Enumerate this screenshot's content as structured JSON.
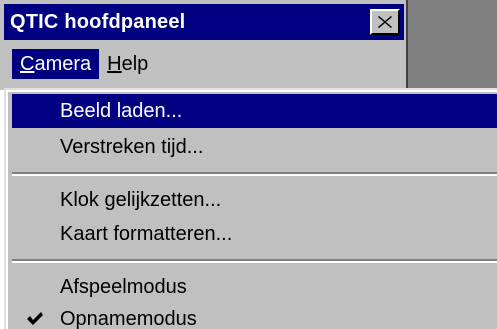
{
  "window": {
    "title": "QTIC hoofdpaneel",
    "close_label": "close"
  },
  "menubar": {
    "items": [
      {
        "label": "Camera",
        "mnemonic": "C",
        "rest": "amera",
        "active": true
      },
      {
        "label": "Help",
        "mnemonic": "H",
        "rest": "elp",
        "active": false
      }
    ]
  },
  "dropdown": {
    "items": [
      {
        "label": "Beeld laden...",
        "highlighted": true
      },
      {
        "label": "Verstreken tijd..."
      },
      {
        "label": "Klok gelijkzetten..."
      },
      {
        "label": "Kaart formatteren..."
      },
      {
        "label": "Afspeelmodus"
      },
      {
        "label": "Opnamemodus",
        "checked": true
      }
    ]
  },
  "colors": {
    "title_bg": "#000080",
    "face": "#c0c0c0",
    "backdrop": "#808080"
  },
  "icons": {
    "close": "close-icon",
    "check": "checkmark-icon"
  }
}
